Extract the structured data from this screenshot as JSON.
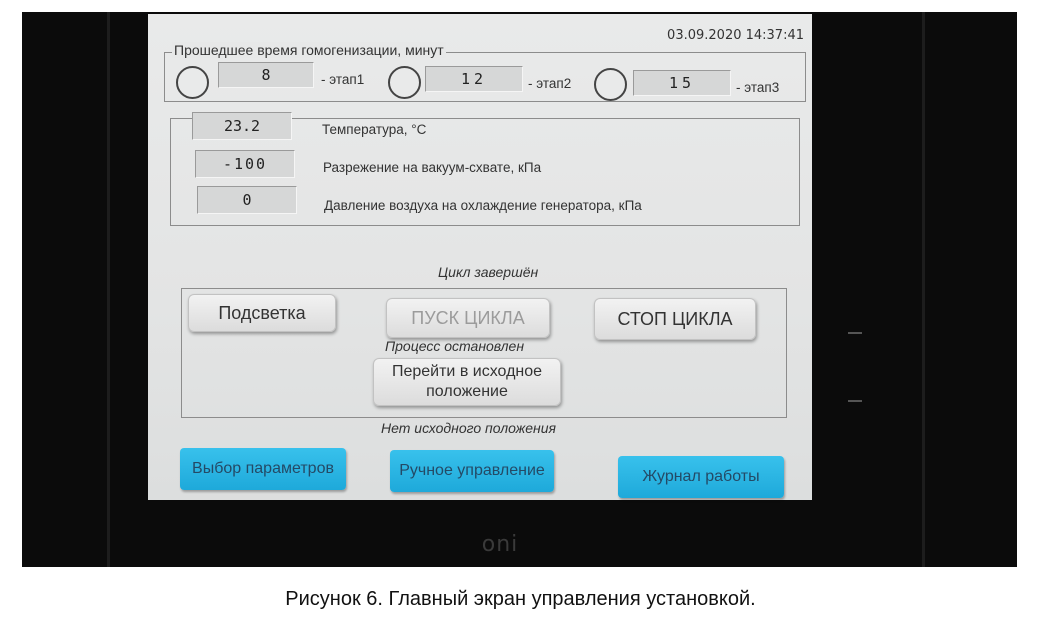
{
  "datetime": "03.09.2020 14:37:41",
  "timer_group": {
    "legend": "Прошедшее время гомогенизации, минут",
    "stages": [
      {
        "value": "8",
        "label": "- этап1"
      },
      {
        "value": "12",
        "label": "- этап2"
      },
      {
        "value": "15",
        "label": "- этап3"
      }
    ]
  },
  "sensors": [
    {
      "value": "23.2",
      "label": "Температура, °С"
    },
    {
      "value": "-100",
      "label": "Разрежение на вакуум-схвате, кПа"
    },
    {
      "value": "0",
      "label": "Давление воздуха на охлаждение генератора, кПа"
    }
  ],
  "cycle_status": "Цикл завершён",
  "controls": {
    "backlight": "Подсветка",
    "start_cycle": "ПУСК ЦИКЛА",
    "stop_cycle": "СТОП ЦИКЛА",
    "process_status": "Процесс остановлен",
    "goto_home": "Перейти в исходное положение"
  },
  "home_status": "Нет исходного положения",
  "nav": {
    "params": "Выбор параметров",
    "manual": "Ручное управление",
    "journal": "Журнал работы"
  },
  "brand": "oni",
  "caption": "Рисунок 6. Главный экран управления установкой."
}
